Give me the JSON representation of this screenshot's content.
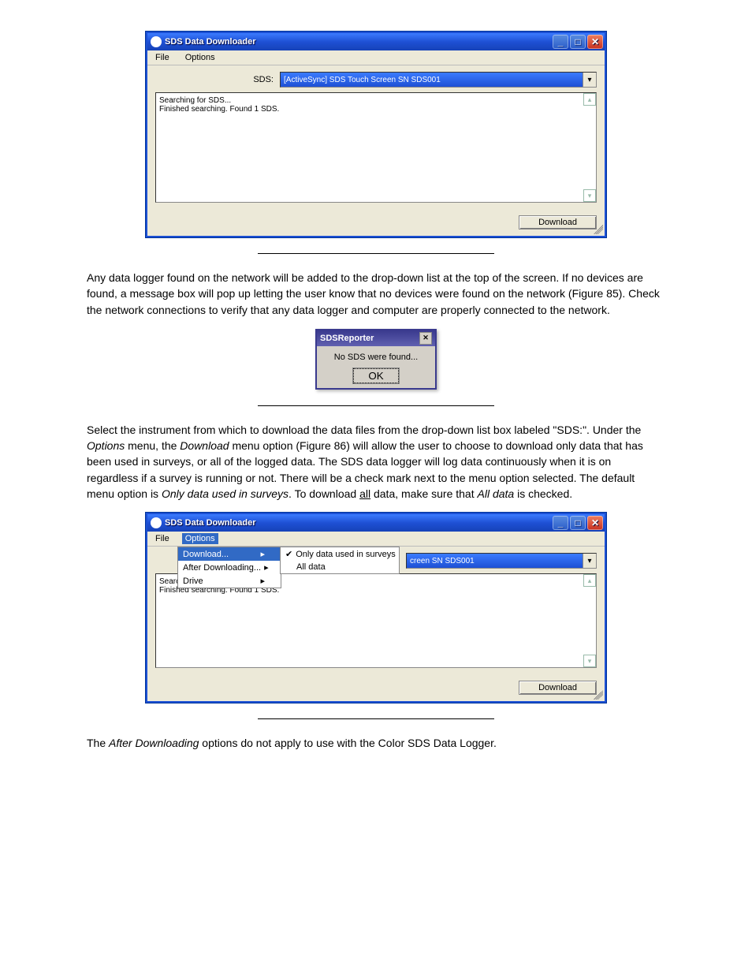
{
  "win1": {
    "title": "SDS Data Downloader",
    "menu": {
      "file": "File",
      "options": "Options"
    },
    "sds_label": "SDS:",
    "combo_value": "[ActiveSync] SDS Touch Screen SN SDS001",
    "log_line1": "Searching for SDS...",
    "log_line2": "Finished searching. Found 1 SDS.",
    "download_btn": "Download"
  },
  "para1": "Any data logger found on the network will be added to the drop-down list at the top of the screen.  If no devices are found, a message box will pop up letting the user know that no devices were found on the network (Figure 85).  Check the network connections to verify that any data logger and computer are properly connected to the network.",
  "msgbox": {
    "title": "SDSReporter",
    "body": "No SDS were found...",
    "ok": "OK"
  },
  "para2_a": "Select the instrument from which to download the data files from the drop-down list box labeled \"SDS:\".  Under the ",
  "para2_options": "Options",
  "para2_b": " menu, the ",
  "para2_download": "Download",
  "para2_c": " menu option (Figure 86) will allow the user to choose to download only data that has been used in surveys, or all of the logged data.  The SDS data logger will log data continuously when it is on regardless if a survey is running or not.  There will be a check mark next to the menu option selected.  The default menu option is ",
  "para2_only": "Only data used in surveys",
  "para2_d": ". To download ",
  "para2_all_u": "all",
  "para2_e": " data, make sure that ",
  "para2_alldata": "All data",
  "para2_f": " is checked.",
  "win2": {
    "title": "SDS Data Downloader",
    "menu": {
      "file": "File",
      "options": "Options"
    },
    "dd1": {
      "download": "Download...",
      "after": "After Downloading...",
      "drive": "Drive"
    },
    "dd2": {
      "only": "Only data used in surveys",
      "all": "All data"
    },
    "combo_partial": "creen SN SDS001",
    "log_line1": "Searc",
    "log_line2": "Finished searching. Found 1 SDS.",
    "download_btn": "Download"
  },
  "para3_a": "The ",
  "para3_after": "After Downloading",
  "para3_b": "  options do not apply to use with the Color SDS Data Logger."
}
